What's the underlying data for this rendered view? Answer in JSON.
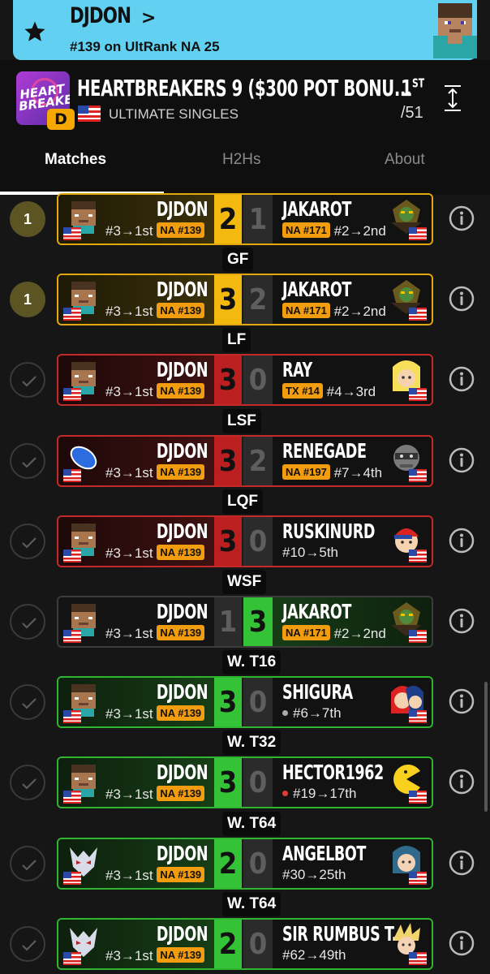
{
  "banner": {
    "player_name": "DJDON",
    "chevron": ">",
    "rank_text": "#139 on UltRank NA 25",
    "bg_color": "#62d1f1"
  },
  "tournament": {
    "logo_text": "HEART BREAKERS",
    "division_badge": "D",
    "title": "HEARTBREAKERS 9 ($300 POT BONU...",
    "event": "ULTIMATE SINGLES",
    "placement": "1",
    "placement_suffix": "ST",
    "entrants": "/51"
  },
  "tabs": [
    {
      "label": "Matches",
      "active": true
    },
    {
      "label": "H2Hs",
      "active": false
    },
    {
      "label": "About",
      "active": false
    }
  ],
  "matches": [
    {
      "round": "",
      "status": "1",
      "result": "win-y",
      "left": {
        "name": "DJDON",
        "seed": "#3→1st",
        "tag": "NA #139",
        "char": "steve"
      },
      "left_score": "2",
      "right_score": "1",
      "right": {
        "name": "JAKAROT",
        "tag": "NA #171",
        "seed": "#2→2nd",
        "char": "ganon"
      }
    },
    {
      "round": "GF",
      "status": "1",
      "result": "win-y",
      "left": {
        "name": "DJDON",
        "seed": "#3→1st",
        "tag": "NA #139",
        "char": "steve"
      },
      "left_score": "3",
      "right_score": "2",
      "right": {
        "name": "JAKAROT",
        "tag": "NA #171",
        "seed": "#2→2nd",
        "char": "ganon"
      }
    },
    {
      "round": "LF",
      "status": "check",
      "result": "lose",
      "left": {
        "name": "DJDON",
        "seed": "#3→1st",
        "tag": "NA #139",
        "char": "steve"
      },
      "left_score": "3",
      "right_score": "0",
      "right": {
        "name": "RAY",
        "tag": "TX #14",
        "seed": "#4→3rd",
        "char": "blonde"
      }
    },
    {
      "round": "LSF",
      "status": "check",
      "result": "lose",
      "left": {
        "name": "DJDON",
        "seed": "#3→1st",
        "tag": "NA #139",
        "char": "capsule"
      },
      "left_score": "3",
      "right_score": "2",
      "right": {
        "name": "RENEGADE",
        "tag": "NA #197",
        "seed": "#7→4th",
        "char": "snake"
      }
    },
    {
      "round": "LQF",
      "status": "check",
      "result": "lose",
      "left": {
        "name": "DJDON",
        "seed": "#3→1st",
        "tag": "NA #139",
        "char": "steve"
      },
      "left_score": "3",
      "right_score": "0",
      "right": {
        "name": "RUSKINURD",
        "tag": "",
        "seed": "#10→5th",
        "char": "ness"
      }
    },
    {
      "round": "WSF",
      "status": "check",
      "result": "neutral",
      "left": {
        "name": "DJDON",
        "seed": "#3→1st",
        "tag": "NA #139",
        "char": "steve"
      },
      "left_score": "1",
      "right_score": "3",
      "right": {
        "name": "JAKAROT",
        "tag": "NA #171",
        "seed": "#2→2nd",
        "char": "ganon"
      }
    },
    {
      "round": "W. T16",
      "status": "check",
      "result": "win-g",
      "left": {
        "name": "DJDON",
        "seed": "#3→1st",
        "tag": "NA #139",
        "char": "steve"
      },
      "left_score": "3",
      "right_score": "0",
      "right": {
        "name": "SHIGURA",
        "tag": "",
        "seed": "#6→7th",
        "dot": "gray",
        "char": "roy"
      }
    },
    {
      "round": "W. T32",
      "status": "check",
      "result": "win-g",
      "left": {
        "name": "DJDON",
        "seed": "#3→1st",
        "tag": "NA #139",
        "char": "steve"
      },
      "left_score": "3",
      "right_score": "0",
      "right": {
        "name": "HECTOR1962",
        "tag": "",
        "seed": "#19→17th",
        "dot": "red",
        "char": "pacman"
      }
    },
    {
      "round": "W. T64",
      "status": "check",
      "result": "win-g",
      "left": {
        "name": "DJDON",
        "seed": "#3→1st",
        "tag": "NA #139",
        "char": "wolf"
      },
      "left_score": "2",
      "right_score": "0",
      "right": {
        "name": "ANGELBOT",
        "tag": "",
        "seed": "#30→25th",
        "char": "byleth"
      }
    },
    {
      "round": "W. T64",
      "status": "check",
      "result": "win-g",
      "left": {
        "name": "DJDON",
        "seed": "#3→1st",
        "tag": "NA #139",
        "char": "wolf"
      },
      "left_score": "2",
      "right_score": "0",
      "right": {
        "name": "SIR RUMBUS T...",
        "tag": "",
        "seed": "#62→49th",
        "char": "cloud"
      }
    }
  ]
}
